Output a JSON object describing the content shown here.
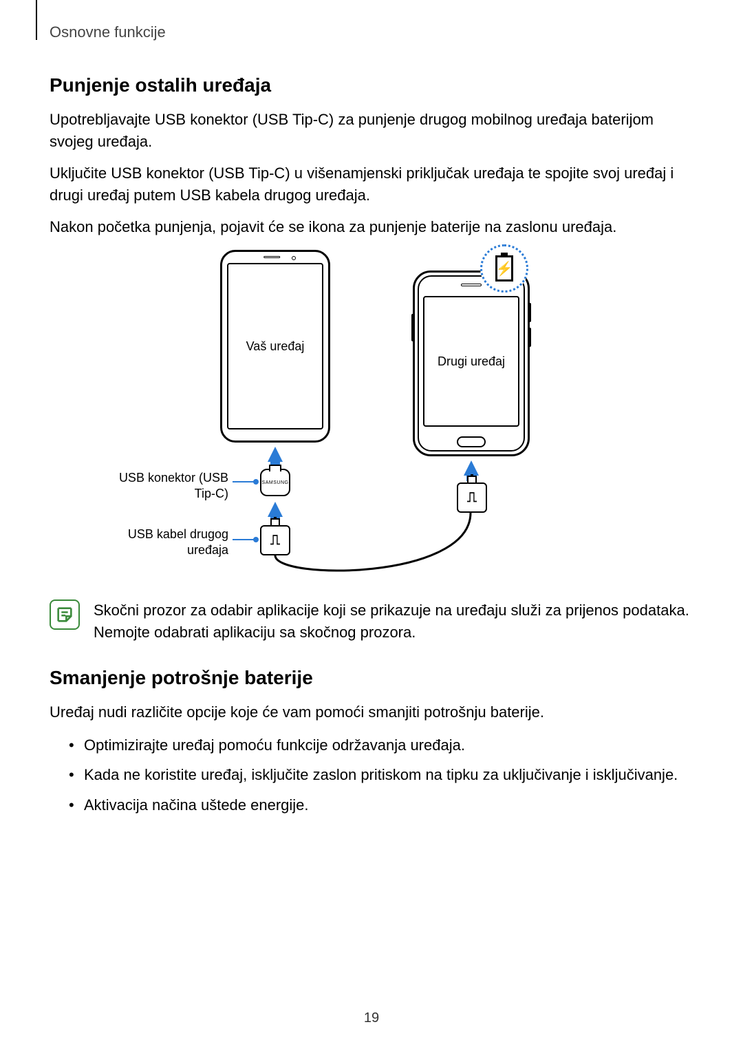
{
  "header": "Osnovne funkcije",
  "section1": {
    "title": "Punjenje ostalih uređaja",
    "p1": "Upotrebljavajte USB konektor (USB Tip-C) za punjenje drugog mobilnog uređaja baterijom svojeg uređaja.",
    "p2": "Uključite USB konektor (USB Tip-C) u višenamjenski priključak uređaja te spojite svoj uređaj i drugi uređaj putem USB kabela drugog uređaja.",
    "p3": "Nakon početka punjenja, pojavit će se ikona za punjenje baterije na zaslonu uređaja."
  },
  "diagram": {
    "your_device": "Vaš uređaj",
    "other_device": "Drugi uređaj",
    "usb_connector": "USB konektor (USB Tip-C)",
    "usb_cable": "USB kabel drugog uređaja",
    "samsung": "SAMSUNG"
  },
  "note": "Skočni prozor za odabir aplikacije koji se prikazuje na uređaju služi za prijenos podataka. Nemojte odabrati aplikaciju sa skočnog prozora.",
  "section2": {
    "title": "Smanjenje potrošnje baterije",
    "intro": "Uređaj nudi različite opcije koje će vam pomoći smanjiti potrošnju baterije.",
    "bullets": [
      "Optimizirajte uređaj pomoću funkcije održavanja uređaja.",
      "Kada ne koristite uređaj, isključite zaslon pritiskom na tipku za uključivanje i isključivanje.",
      "Aktivacija načina uštede energije."
    ]
  },
  "page_number": "19"
}
